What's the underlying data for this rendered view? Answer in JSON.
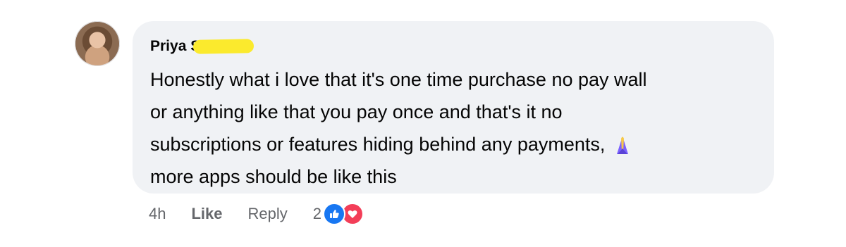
{
  "comment": {
    "author": "Priya S",
    "author_redacted": true,
    "text_lines": [
      "Honestly what i love that it's one time purchase no pay wall",
      "or anything like that you pay once and that's it no",
      "subscriptions or features hiding behind any payments,",
      "more apps should be like this"
    ],
    "emoji": "folded-hands-emoji"
  },
  "actions": {
    "time": "4h",
    "like_label": "Like",
    "reply_label": "Reply",
    "reaction_count": "2",
    "reactions": [
      "like",
      "love"
    ]
  },
  "colors": {
    "bubble_bg": "#f0f2f5",
    "text": "#050505",
    "meta_text": "#65676b",
    "like_blue": "#1877f2",
    "love_red": "#f33e58",
    "redaction": "#fbea2d"
  }
}
